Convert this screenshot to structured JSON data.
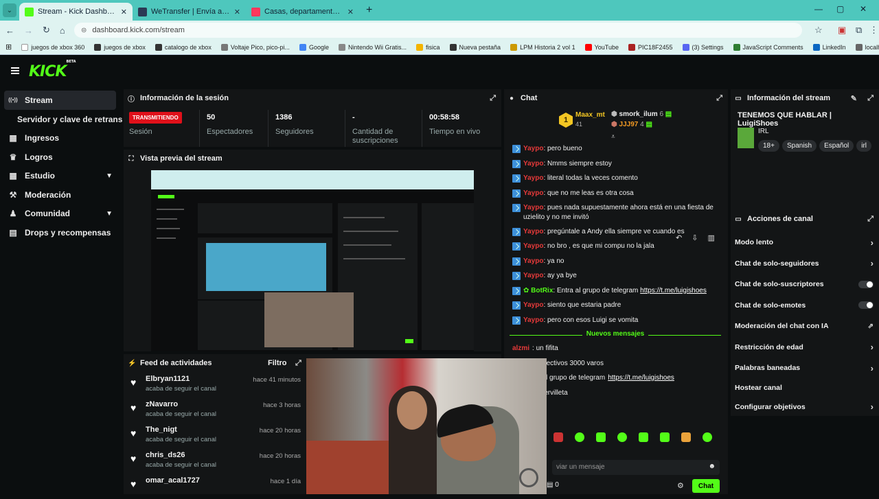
{
  "browser": {
    "tabs": [
      {
        "label": "Stream - Kick Dashboard",
        "fav_color": "#53fc18",
        "active": true
      },
      {
        "label": "WeTransfer | Envía archivos gra",
        "fav_color": "#2b3a55",
        "active": false
      },
      {
        "label": "Casas, departamentos y renta",
        "fav_color": "#ff385c",
        "active": false
      }
    ],
    "url": "dashboard.kick.com/stream",
    "bookmarks": [
      {
        "label": "juegos de xbox 360",
        "color": "#ffffff"
      },
      {
        "label": "juegos de xbox",
        "color": "#333333"
      },
      {
        "label": "catalogo de xbox",
        "color": "#333333"
      },
      {
        "label": "Voltaje Pico, pico-pi...",
        "color": "#777777"
      },
      {
        "label": "Google",
        "color": "#4285f4"
      },
      {
        "label": "Nintendo Wii Gratis...",
        "color": "#888888"
      },
      {
        "label": "fisica",
        "color": "#f4b400"
      },
      {
        "label": "Nueva pestaña",
        "color": "#333333"
      },
      {
        "label": "LPM Historia 2 vol 1",
        "color": "#cc9900"
      },
      {
        "label": "YouTube",
        "color": "#ff0000"
      },
      {
        "label": "PIC18F2455",
        "color": "#aa2222"
      },
      {
        "label": "(3) Settings",
        "color": "#5865f2"
      },
      {
        "label": "JavaScript Comments",
        "color": "#2e7d32"
      },
      {
        "label": "LinkedIn",
        "color": "#0a66c2"
      },
      {
        "label": "localhost / 127.0.0.1...",
        "color": "#666666"
      }
    ]
  },
  "kick": {
    "logo": "KICK",
    "logo_sup": "BETA",
    "sidebar": {
      "items": [
        {
          "label": "Stream",
          "icon": "broadcast-icon",
          "glyph": "((•))"
        },
        {
          "label": "Servidor y clave de retransmisión",
          "sub": true
        },
        {
          "label": "Ingresos",
          "icon": "chart-icon",
          "glyph": "▦"
        },
        {
          "label": "Logros",
          "icon": "trophy-icon",
          "glyph": "♛"
        },
        {
          "label": "Estudio",
          "icon": "grid-icon",
          "glyph": "▦",
          "chevron": true
        },
        {
          "label": "Moderación",
          "icon": "wrench-icon",
          "glyph": "⚒"
        },
        {
          "label": "Comunidad",
          "icon": "users-icon",
          "glyph": "♟",
          "chevron": true
        },
        {
          "label": "Drops y recompensas",
          "icon": "gift-icon",
          "glyph": "▤"
        }
      ]
    },
    "session": {
      "title": "Información de la sesión",
      "status": "TRANSMITIENDO",
      "status_label": "Sesión",
      "stats": [
        {
          "value": "50",
          "label": "Espectadores"
        },
        {
          "value": "1386",
          "label": "Seguidores"
        },
        {
          "value": "-",
          "label": "Cantidad de suscripciones"
        },
        {
          "value": "00:58:58",
          "label": "Tiempo en vivo"
        }
      ]
    },
    "preview": {
      "title": "Vista previa del stream"
    },
    "feed": {
      "title": "Feed de actividades",
      "filter": "Filtro",
      "items": [
        {
          "name": "Elbryan1121",
          "action": "acaba de seguir el canal",
          "time": "hace 41 minutos"
        },
        {
          "name": "zNavarro",
          "action": "acaba de seguir el canal",
          "time": "hace 3 horas"
        },
        {
          "name": "The_nigt",
          "action": "acaba de seguir el canal",
          "time": "hace 20 horas"
        },
        {
          "name": "chris_ds26",
          "action": "acaba de seguir el canal",
          "time": "hace 20 horas"
        },
        {
          "name": "omar_acal1727",
          "action": "",
          "time": "hace 1 día"
        }
      ]
    },
    "chat": {
      "title": "Chat",
      "leaderboard": [
        {
          "rank": "1",
          "name": "Maax_mt",
          "count": "41"
        },
        {
          "rank": "",
          "name": "smork_ilum",
          "count": "6"
        },
        {
          "rank": "",
          "name": "JJJ97",
          "count": "4"
        }
      ],
      "messages": [
        {
          "user": "Yaypo",
          "text": ": pero bueno"
        },
        {
          "user": "Yaypo",
          "text": ": Nmms siempre estoy"
        },
        {
          "user": "Yaypo",
          "text": ": literal todas la veces comento"
        },
        {
          "user": "Yaypo",
          "text": ": que no me leas es otra cosa"
        },
        {
          "user": "Yaypo",
          "text": ": pues nada supuestamente ahora está en una fiesta de uzielito y no me invitó"
        },
        {
          "user": "Yaypo",
          "text": ": pregúntale a Andy ella siempre ve cuando es"
        },
        {
          "user": "Yaypo",
          "text": ": no bro , es que mi compu no la jala"
        },
        {
          "user": "Yaypo",
          "text": ": ya no"
        },
        {
          "user": "Yaypo",
          "text": ": ay ya bye"
        },
        {
          "user": "BotRix",
          "text": ": Entra al grupo de telegram ",
          "link": "https://t.me/luigishoes",
          "bot": true
        },
        {
          "user": "Yaypo",
          "text": ": siento que estaria padre"
        },
        {
          "user": "Yaypo",
          "text": ": pero con esos Luigi se vomita"
        }
      ],
      "new_messages": "Nuevos mensajes",
      "after": [
        {
          "user": "alzmi",
          "text": ": un fifita"
        },
        {
          "user": "",
          "text": "y sus respectivos 3000 varos"
        },
        {
          "user": "",
          "text": "ix: Entra al grupo de telegram ",
          "link": "https://t.me/luigishoes"
        },
        {
          "user": "",
          "text": "llegó su servilleta"
        }
      ],
      "input_placeholder": "viar un mensaje",
      "points": "0",
      "send": "Chat"
    },
    "stream_info": {
      "title": "Información del stream",
      "stream_title": "TENEMOS QUE HABLAR | LuigiShoes",
      "category": "IRL",
      "tags": [
        "18+",
        "Spanish",
        "Español",
        "irl"
      ]
    },
    "actions": {
      "title": "Acciones de canal",
      "rows": [
        {
          "label": "Modo lento",
          "type": "arrow"
        },
        {
          "label": "Chat de solo-seguidores",
          "type": "arrow"
        },
        {
          "label": "Chat de solo-suscriptores",
          "type": "toggle"
        },
        {
          "label": "Chat de solo-emotes",
          "type": "toggle"
        },
        {
          "label": "Moderación del chat con IA",
          "type": "external"
        },
        {
          "label": "Restricción de edad",
          "type": "arrow"
        },
        {
          "label": "Palabras baneadas",
          "type": "arrow"
        },
        {
          "label": "Hostear canal",
          "type": "none"
        },
        {
          "label": "Configurar objetivos",
          "type": "arrow"
        }
      ]
    }
  },
  "colors": {
    "brand": "#53fc18",
    "live": "#e0101a",
    "chat_user": "#e83a3a"
  }
}
